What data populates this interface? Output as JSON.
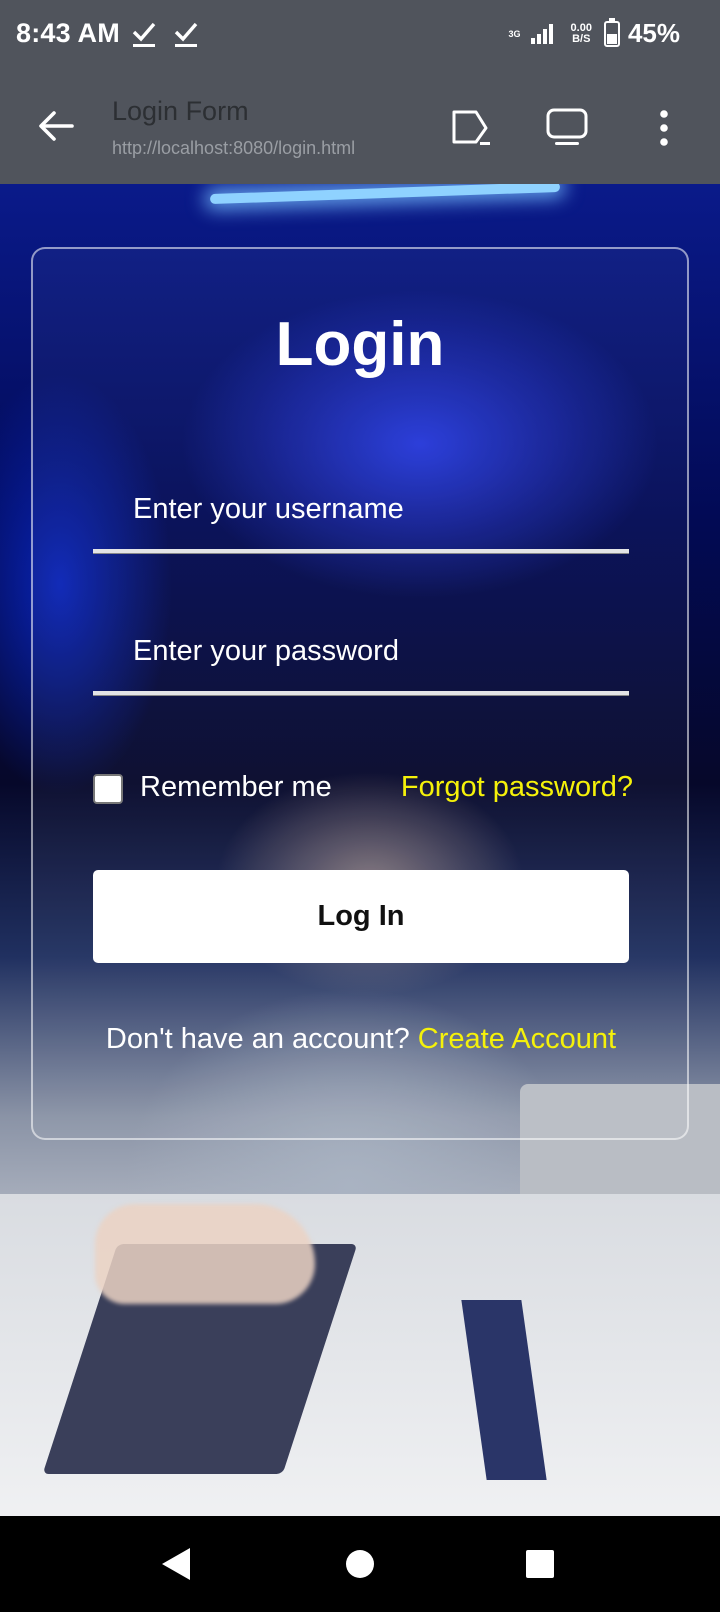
{
  "status_bar": {
    "time": "8:43 AM",
    "network_type": "3G",
    "speed_value": "0.00",
    "speed_unit": "B/S",
    "battery_percent": "45%",
    "battery_level": 0.45,
    "icons": [
      "check-icon",
      "check-icon",
      "signal-icon",
      "battery-icon"
    ]
  },
  "app_bar": {
    "title": "Login Form",
    "url": "http://localhost:8080/login.html",
    "icons": [
      "back-arrow-icon",
      "cast-icon",
      "desktop-view-icon",
      "more-vert-icon"
    ]
  },
  "login_card": {
    "title": "Login",
    "username_placeholder": "Enter your username",
    "password_placeholder": "Enter your password",
    "remember_label": "Remember me",
    "remember_checked": false,
    "forgot_label": "Forgot password?",
    "login_button": "Log In",
    "signup_prompt": "Don't have an account?",
    "signup_link": "Create Account"
  },
  "colors": {
    "link": "#f5f10a",
    "toolbar": "#50545c"
  },
  "nav_bar": {
    "icons": [
      "back-triangle-icon",
      "home-circle-icon",
      "recents-square-icon"
    ]
  }
}
